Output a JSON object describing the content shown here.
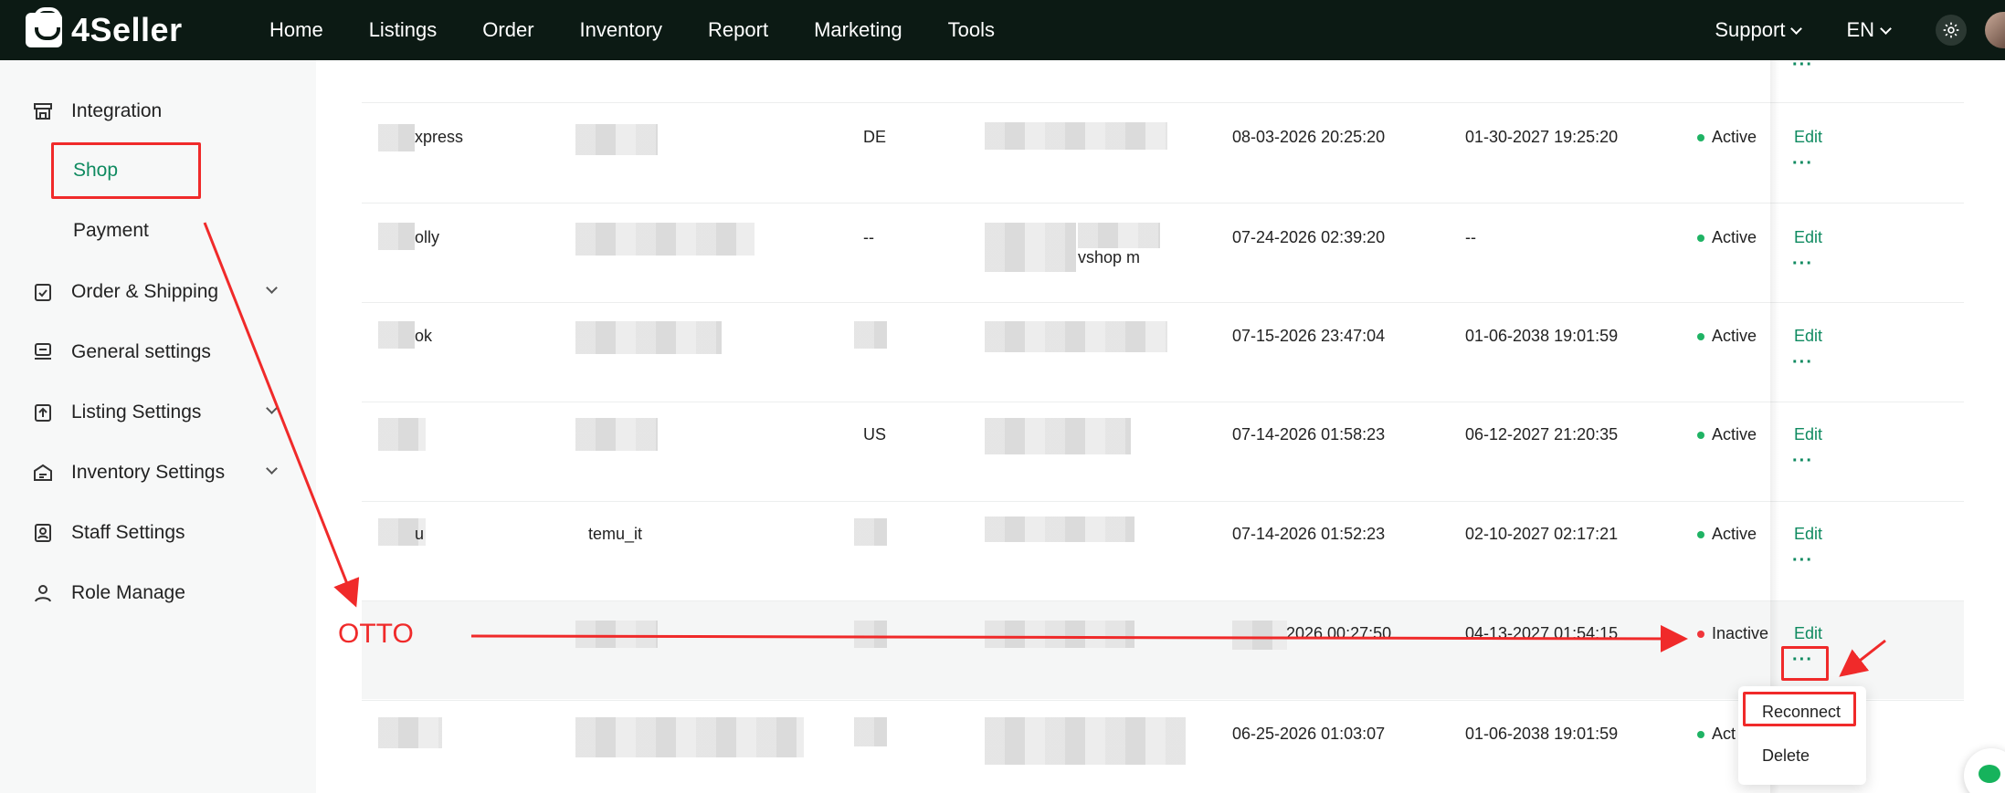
{
  "brand": {
    "name": "4Seller"
  },
  "topnav": {
    "items": [
      "Home",
      "Listings",
      "Order",
      "Inventory",
      "Report",
      "Marketing",
      "Tools"
    ],
    "support": "Support",
    "language": "EN"
  },
  "sidebar": {
    "integration": "Integration",
    "shop": "Shop",
    "payment": "Payment",
    "order_shipping": "Order & Shipping",
    "general_settings": "General settings",
    "listing_settings": "Listing Settings",
    "inventory_settings": "Inventory Settings",
    "staff_settings": "Staff Settings",
    "role_manage": "Role Manage"
  },
  "rows": [
    {
      "shop_fragment": "",
      "account": "",
      "site": "",
      "created": "",
      "expires": "",
      "status": "",
      "edit": "",
      "more": "···"
    },
    {
      "shop_fragment": "xpress",
      "account": "",
      "site": "DE",
      "created": "08-03-2026 20:25:20",
      "expires": "01-30-2027 19:25:20",
      "status": "Active",
      "edit": "Edit",
      "more": "···"
    },
    {
      "shop_fragment": "olly",
      "account": "",
      "site": "--",
      "store_fragment": "vshop     m",
      "created": "07-24-2026 02:39:20",
      "expires": "--",
      "status": "Active",
      "edit": "Edit",
      "more": "···"
    },
    {
      "shop_fragment": "ok",
      "account": "",
      "site": "",
      "created": "07-15-2026 23:47:04",
      "expires": "01-06-2038 19:01:59",
      "status": "Active",
      "edit": "Edit",
      "more": "···"
    },
    {
      "shop_fragment": "",
      "account": "",
      "site": "US",
      "created": "07-14-2026 01:58:23",
      "expires": "06-12-2027 21:20:35",
      "status": "Active",
      "edit": "Edit",
      "more": "···"
    },
    {
      "shop_fragment": "u",
      "account": "temu_it",
      "site": "",
      "created": "07-14-2026 01:52:23",
      "expires": "02-10-2027 02:17:21",
      "status": "Active",
      "edit": "Edit",
      "more": "···"
    },
    {
      "shop_fragment": "",
      "account": "",
      "site": "",
      "created": "2026 00:27:50",
      "expires": "04-13-2027 01:54:15",
      "status": "Inactive",
      "edit": "Edit",
      "more": "···"
    },
    {
      "shop_fragment": "",
      "account": "",
      "site": "",
      "created": "06-25-2026 01:03:07",
      "expires": "01-06-2038 19:01:59",
      "status": "Act",
      "edit": "",
      "more": ""
    }
  ],
  "menu": {
    "reconnect": "Reconnect",
    "delete": "Delete"
  },
  "annotation": {
    "otto_label": "OTTO"
  },
  "colors": {
    "accent": "#0f8a60",
    "active": "#1fb364",
    "inactive": "#f0353a",
    "annotation": "#f02a2a",
    "topbar": "#0c1a14"
  }
}
